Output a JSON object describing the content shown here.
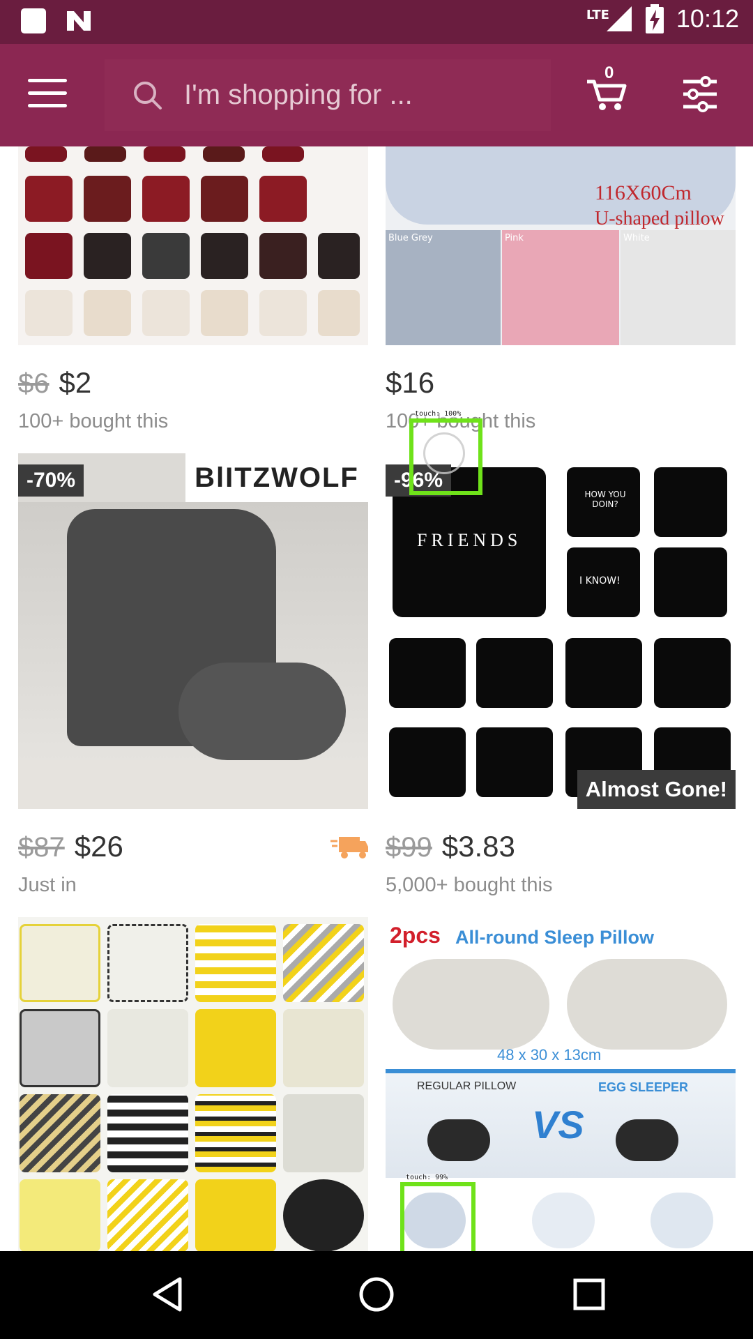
{
  "status_bar": {
    "network": "LTE",
    "time": "10:12"
  },
  "search": {
    "placeholder": "I'm shopping for ..."
  },
  "cart": {
    "count": "0"
  },
  "products": [
    {
      "old_price": "$6",
      "price": "$2",
      "subtitle": "100+ bought this"
    },
    {
      "old_price": "",
      "price": "$16",
      "subtitle": "100+ bought this",
      "image_text": [
        "116X60Cm",
        "U-shaped pillow",
        "Blue Grey",
        "Pink",
        "White"
      ]
    },
    {
      "badge": "-70%",
      "brand": "BlITZWOLF",
      "old_price": "$87",
      "price": "$26",
      "subtitle": "Just in"
    },
    {
      "badge": "-96%",
      "tag": "Almost Gone!",
      "old_price": "$99",
      "price": "$3.83",
      "subtitle": "5,000+ bought this",
      "image_text": [
        "FRIENDS",
        "HOW YOU DOIN?",
        "I KNOW!"
      ]
    },
    {},
    {
      "image_text": [
        "2pcs",
        "All-round Sleep Pillow",
        "48 x 30 x 13cm",
        "REGULAR PILLOW",
        "VS",
        "EGG SLEEPER"
      ]
    }
  ],
  "touch_labels": [
    "touch: 100%",
    "touch: 99%"
  ],
  "colors": {
    "status_bar": "#6a1d3f",
    "app_bar": "#8b2752"
  }
}
